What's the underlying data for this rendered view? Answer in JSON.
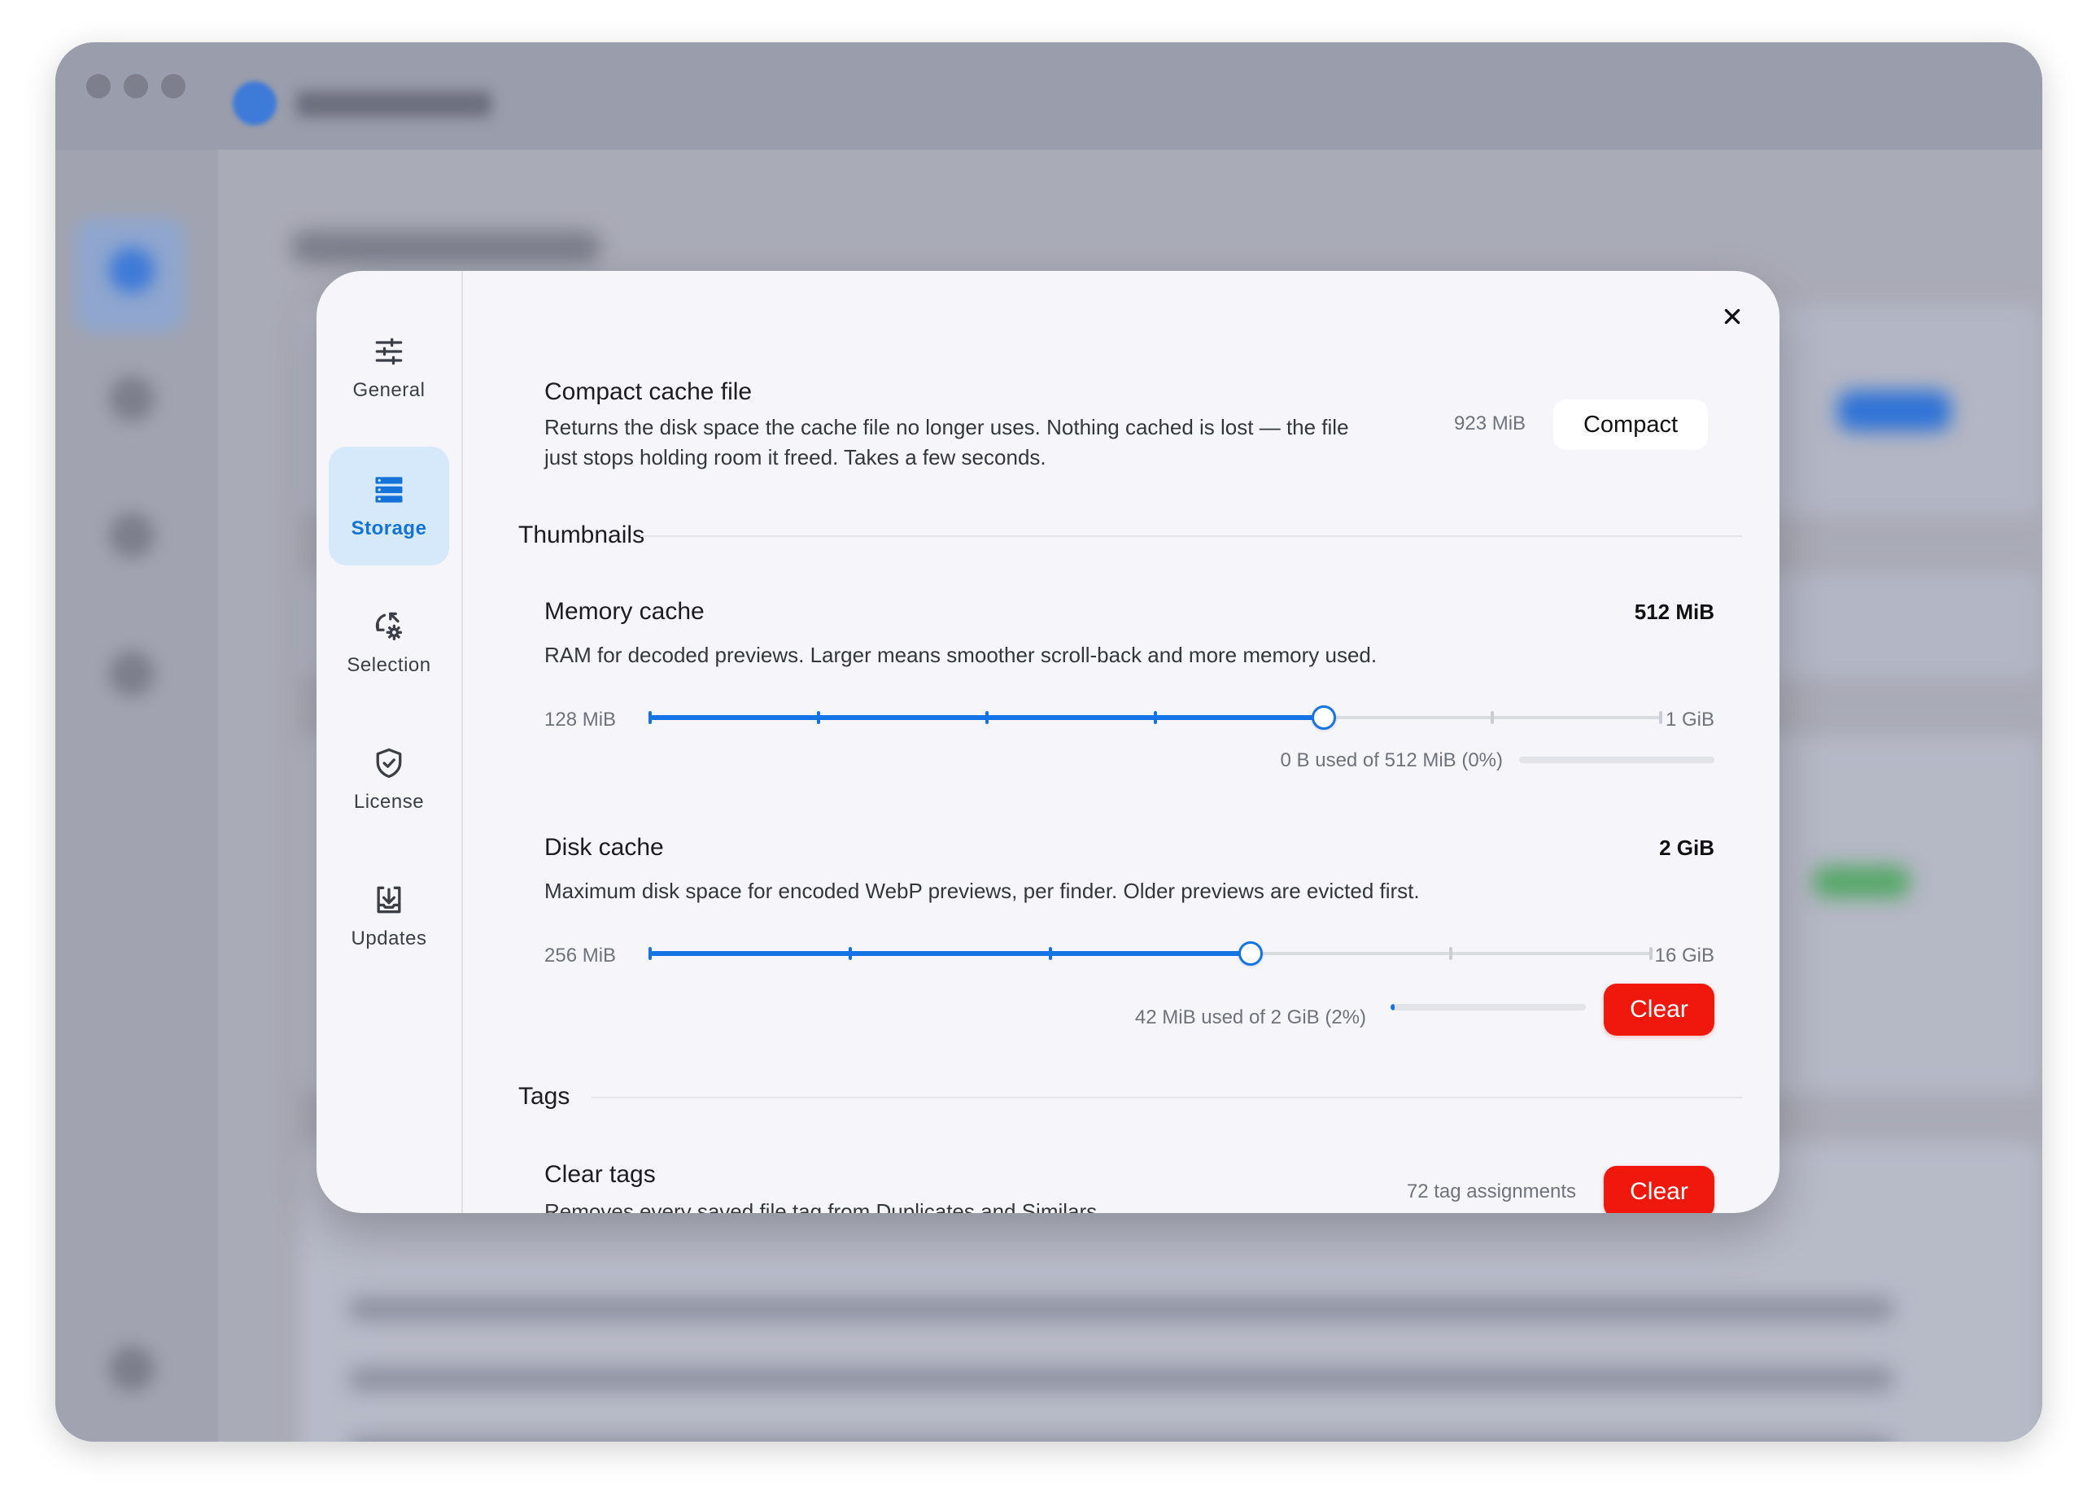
{
  "nav": {
    "items": [
      {
        "label": "General",
        "icon": "sliders-icon",
        "active": false
      },
      {
        "label": "Storage",
        "icon": "storage-icon",
        "active": true
      },
      {
        "label": "Selection",
        "icon": "selection-gear-icon",
        "active": false
      },
      {
        "label": "License",
        "icon": "shield-check-icon",
        "active": false
      },
      {
        "label": "Updates",
        "icon": "download-tray-icon",
        "active": false
      }
    ]
  },
  "compact": {
    "title": "Compact cache file",
    "description_line1": "Returns the disk space the cache file no longer uses. Nothing cached is lost — the file",
    "description_line2": "just stops holding room it freed. Takes a few seconds.",
    "size": "923 MiB",
    "button_label": "Compact"
  },
  "thumbnails": {
    "section_label": "Thumbnails",
    "memory_cache": {
      "title": "Memory cache",
      "value": "512 MiB",
      "description": "RAM for decoded previews. Larger means smoother scroll-back and more memory used.",
      "min_label": "128 MiB",
      "max_label": "1 GiB",
      "steps": 7,
      "selected_step": 4,
      "usage_text": "0 B used of 512 MiB (0%)",
      "usage_fraction": 0.0
    },
    "disk_cache": {
      "title": "Disk cache",
      "value": "2 GiB",
      "description": "Maximum disk space for encoded WebP previews, per finder. Older previews are evicted first.",
      "min_label": "256 MiB",
      "max_label": "16 GiB",
      "steps": 6,
      "selected_step": 3,
      "usage_text": "42 MiB used of 2 GiB (2%)",
      "usage_fraction": 0.02,
      "clear_label": "Clear"
    }
  },
  "tags": {
    "section_label": "Tags",
    "clear_tags": {
      "title": "Clear tags",
      "description": "Removes every saved file tag from Duplicates and Similars.",
      "count": "72 tag assignments",
      "clear_label": "Clear"
    }
  },
  "colors": {
    "accent": "#1474e5",
    "danger": "#f0180c",
    "active_nav_bg": "#d6e9fb"
  }
}
